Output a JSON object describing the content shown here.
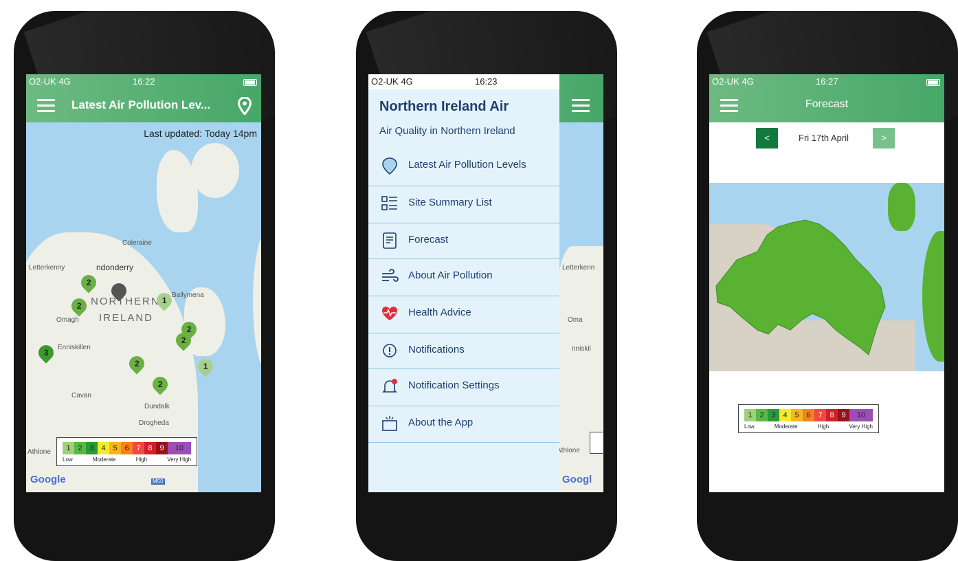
{
  "phone1": {
    "status": {
      "carrier": "O2-UK  4G",
      "time": "16:22"
    },
    "title": "Latest Air Pollution Lev...",
    "last_updated": "Last updated: Today 14pm",
    "places": [
      "Coleraine",
      "Letterkenny",
      "ndonderry",
      "NORTHERN",
      "IRELAND",
      "Omagh",
      "Ballymena",
      "Enniskillen",
      "Cavan",
      "Dundalk",
      "Drogheda",
      "Athlone",
      "M50"
    ],
    "markers": [
      {
        "value": "2",
        "color": "#6ab045"
      },
      {
        "value": "2",
        "color": "#6ab045"
      },
      {
        "value": "",
        "color": "#555555"
      },
      {
        "value": "1",
        "color": "#a8d08d"
      },
      {
        "value": "2",
        "color": "#6ab045"
      },
      {
        "value": "3",
        "color": "#3c9a2c"
      },
      {
        "value": "2",
        "color": "#6ab045"
      },
      {
        "value": "2",
        "color": "#6ab045"
      },
      {
        "value": "1",
        "color": "#a8d08d"
      },
      {
        "value": "2",
        "color": "#6ab045"
      }
    ],
    "brand": "Google"
  },
  "phone2": {
    "status": {
      "carrier": "O2-UK  4G",
      "time": "16:23"
    },
    "drawer_title": "Northern Ireland Air",
    "drawer_subtitle": "Air Quality in Northern Ireland",
    "menu": [
      {
        "label": "Latest Air Pollution Levels",
        "icon": "map-pin-icon"
      },
      {
        "label": "Site Summary List",
        "icon": "list-icon"
      },
      {
        "label": "Forecast",
        "icon": "forecast-document-icon"
      },
      {
        "label": "About Air Pollution",
        "icon": "wind-icon"
      },
      {
        "label": "Health Advice",
        "icon": "heart-pulse-icon"
      },
      {
        "label": "Notifications",
        "icon": "alert-circle-icon"
      },
      {
        "label": "Notification Settings",
        "icon": "bell-icon"
      },
      {
        "label": "About the App",
        "icon": "info-board-icon"
      }
    ],
    "background_places": [
      "Letterkenn",
      "Oma",
      "nniskil"
    ],
    "background_brand": "Googl",
    "background_place_athlone": "Athlone"
  },
  "phone3": {
    "status": {
      "carrier": "O2-UK  4G",
      "time": "16:27"
    },
    "title": "Forecast",
    "prev_label": "<",
    "next_label": ">",
    "date": "Fri 17th April"
  },
  "legend": {
    "levels": [
      {
        "value": "1",
        "color": "#9fd07c"
      },
      {
        "value": "2",
        "color": "#58b847"
      },
      {
        "value": "3",
        "color": "#2a9a35"
      },
      {
        "value": "4",
        "color": "#f6ea2b"
      },
      {
        "value": "5",
        "color": "#f7b51e"
      },
      {
        "value": "6",
        "color": "#f4831f"
      },
      {
        "value": "7",
        "color": "#ee4a41"
      },
      {
        "value": "8",
        "color": "#d41f26"
      },
      {
        "value": "9",
        "color": "#951418"
      },
      {
        "value": "10",
        "color": "#9b4fb6"
      }
    ],
    "bands": [
      "Low",
      "Moderate",
      "High",
      "Very High"
    ]
  },
  "colors": {
    "appbar": "#3a9c60",
    "drawer": "#e4f3fb",
    "forecast_land": "#5ab232",
    "sea": "#a9d4ef"
  }
}
